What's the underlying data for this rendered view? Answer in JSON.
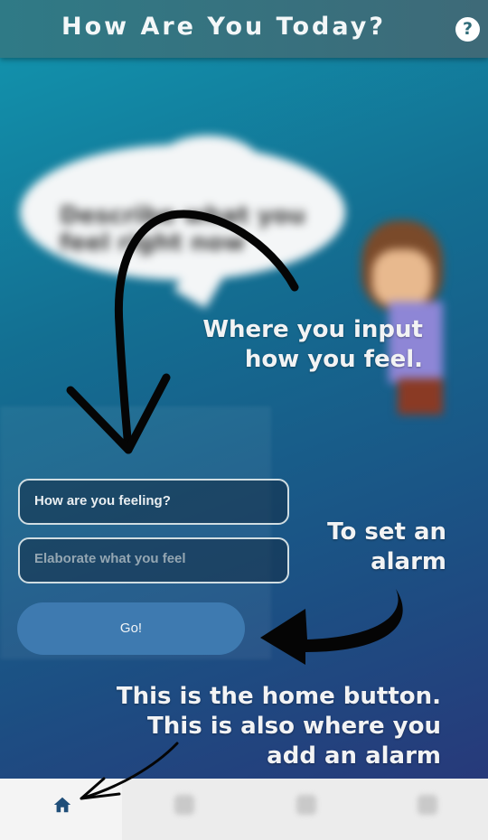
{
  "header": {
    "title": "How Are You Today?",
    "help_glyph": "?"
  },
  "background": {
    "bubble_text": "Describe what you feel right now"
  },
  "form": {
    "feeling_value": "How are you feeling?",
    "elaborate_placeholder": "Elaborate what you feel",
    "go_label": "Go!"
  },
  "annotations": {
    "input_note": "Where you input how you feel.",
    "alarm_note": "To set an alarm",
    "home_note": "This is the home button. This is also where you add an alarm"
  },
  "nav": {
    "items": [
      "home-icon",
      "blurred-icon",
      "blurred-icon",
      "blurred-icon"
    ]
  },
  "colors": {
    "accent": "#3e7ab0",
    "header": "#2f7a86",
    "nav": "#ececec"
  }
}
